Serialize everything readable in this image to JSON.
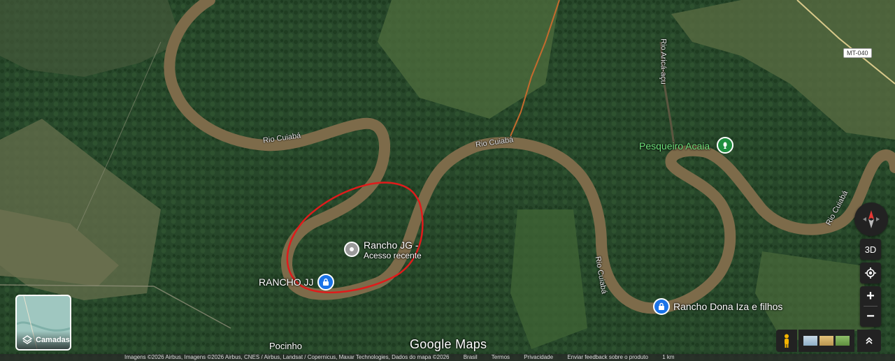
{
  "map": {
    "places": {
      "rancho_jg": {
        "line1": "Rancho JG -",
        "line2": "Acesso recente"
      },
      "rancho_jj": "RANCHO JJ",
      "pesqueiro": "Pesqueiro Acaia",
      "rancho_dona": "Rancho Dona Iza e filhos",
      "pocinho": "Pocinho"
    },
    "rivers": {
      "cuiaba_1": "Rio Cuiabá",
      "cuiaba_2": "Rio Cuiabá",
      "cuiaba_3": "Rio Cuiabá",
      "cuiaba_4": "Rio Cuiabá",
      "arica": "Rio Aricá-açu"
    },
    "road_shield": "MT-040",
    "watermark": "Google Maps"
  },
  "controls": {
    "layers_label": "Camadas",
    "view_3d": "3D",
    "zoom_in": "+",
    "zoom_out": "−"
  },
  "attribution": {
    "imagery": "Imagens ©2026 Airbus, Imagens ©2026 Airbus, CNES / Airbus, Landsat / Copernicus, Maxar Technologies, Dados do mapa ©2026",
    "country": "Brasil",
    "terms": "Termos",
    "privacy": "Privacidade",
    "feedback": "Enviar feedback sobre o produto",
    "scale": "1 km"
  },
  "colors": {
    "river": "#7d6b4a",
    "forest": "#254a22",
    "annotation": "#e01b1b",
    "pin_blue": "#1a73e8",
    "pin_green": "#1e8e3e",
    "pesqueiro_text": "#6ee07a"
  },
  "icons": {
    "layers": "layers-icon",
    "compass": "compass-icon",
    "location": "my-location-icon",
    "pegman": "pegman-icon",
    "expand": "chevron-up-icon"
  }
}
